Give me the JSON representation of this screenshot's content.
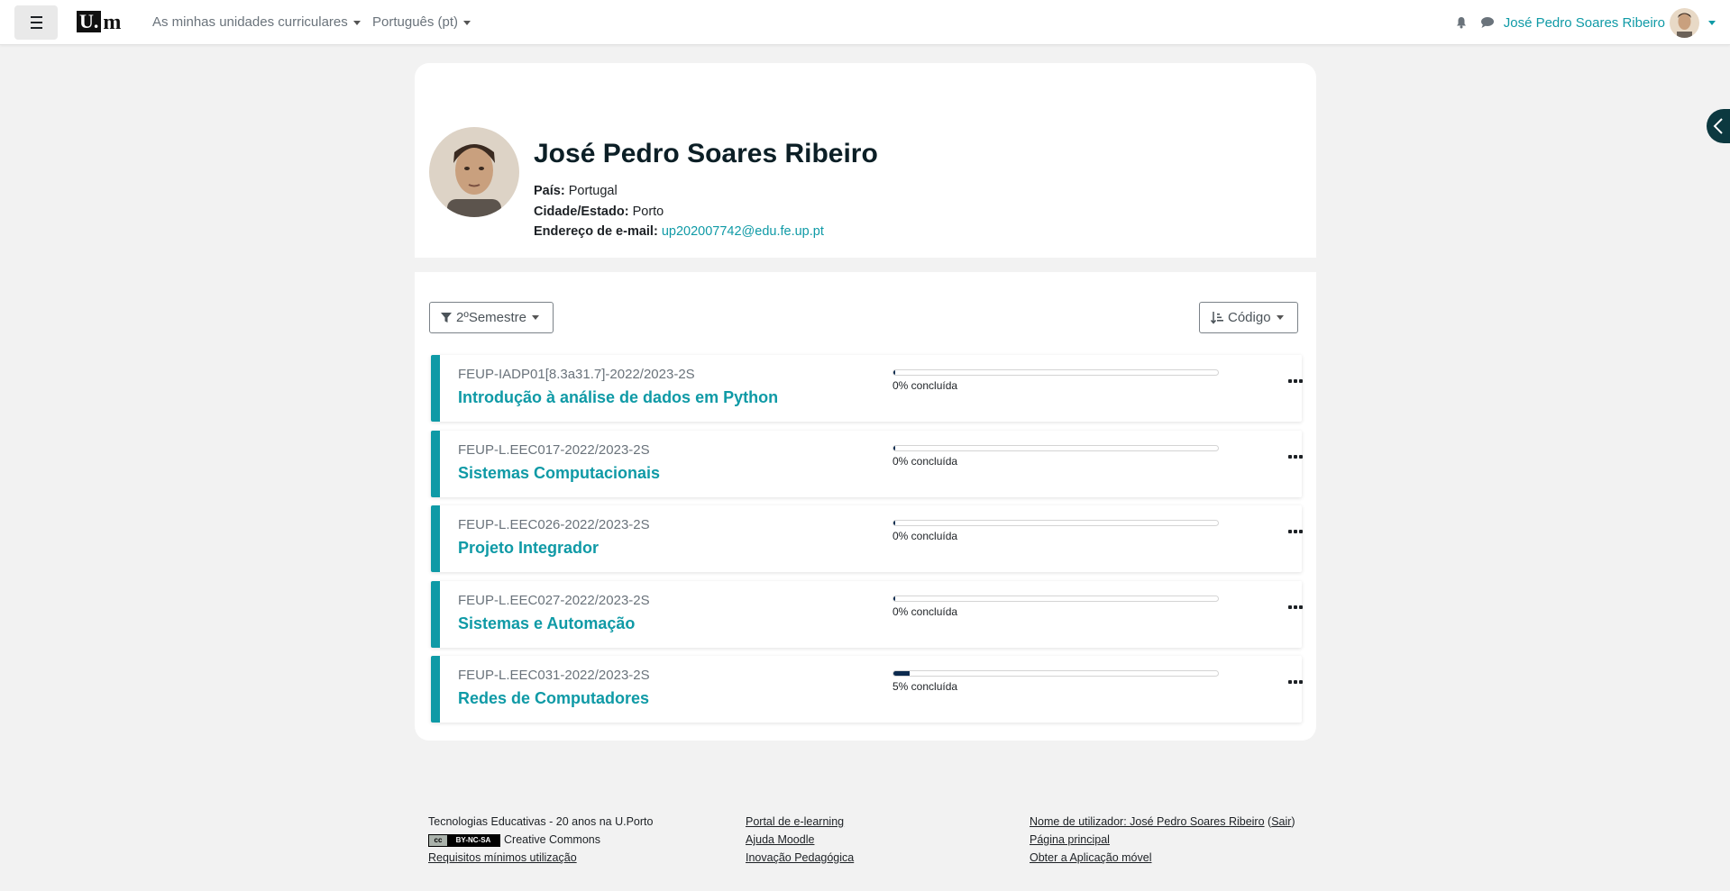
{
  "navbar": {
    "menu_icon": "hamburger-icon",
    "logo": {
      "u": "U.",
      "m": "m"
    },
    "my_courses_label": "As minhas unidades curriculares",
    "language_label": "Português (pt)",
    "notification_icon": "bell-icon",
    "messages_icon": "chat-icon",
    "user_name": "José Pedro Soares Ribeiro"
  },
  "profile": {
    "name": "José Pedro Soares Ribeiro",
    "country_label": "País:",
    "country_value": "Portugal",
    "city_label": "Cidade/Estado:",
    "city_value": "Porto",
    "email_label": "Endereço de e-mail:",
    "email_value": "up202007742@edu.fe.up.pt"
  },
  "courses_section": {
    "filter_label": "2ºSemestre",
    "sort_label": "Código",
    "courses": [
      {
        "code": "FEUP-IADP01[8.3a31.7]-2022/2023-2S",
        "title": "Introdução à análise de dados em Python",
        "progress": 0,
        "progress_label": "0% concluída"
      },
      {
        "code": "FEUP-L.EEC017-2022/2023-2S",
        "title": "Sistemas Computacionais",
        "progress": 0,
        "progress_label": "0% concluída"
      },
      {
        "code": "FEUP-L.EEC026-2022/2023-2S",
        "title": "Projeto Integrador",
        "progress": 0,
        "progress_label": "0% concluída"
      },
      {
        "code": "FEUP-L.EEC027-2022/2023-2S",
        "title": "Sistemas e Automação",
        "progress": 0,
        "progress_label": "0% concluída"
      },
      {
        "code": "FEUP-L.EEC031-2022/2023-2S",
        "title": "Redes de Computadores",
        "progress": 5,
        "progress_label": "5% concluída"
      }
    ]
  },
  "footer": {
    "col1": {
      "text": "Tecnologias Educativas - 20 anos na U.Porto",
      "cc_badge": "BY-NC-SA",
      "cc_label": "Creative Commons",
      "requirements_link": "Requisitos mínimos utilização"
    },
    "col2": {
      "portal_link": "Portal de e-learning",
      "help_link": "Ajuda Moodle",
      "innovation_link": "Inovação Pedagógica"
    },
    "col3": {
      "username_link": "Nome de utilizador: José Pedro Soares Ribeiro",
      "logout_link": "Sair",
      "home_link": "Página principal",
      "app_link": "Obter a Aplicação móvel"
    }
  },
  "colors": {
    "accent": "#0f9aa6",
    "dark": "#0c3940",
    "progress": "#0c2a4e"
  }
}
